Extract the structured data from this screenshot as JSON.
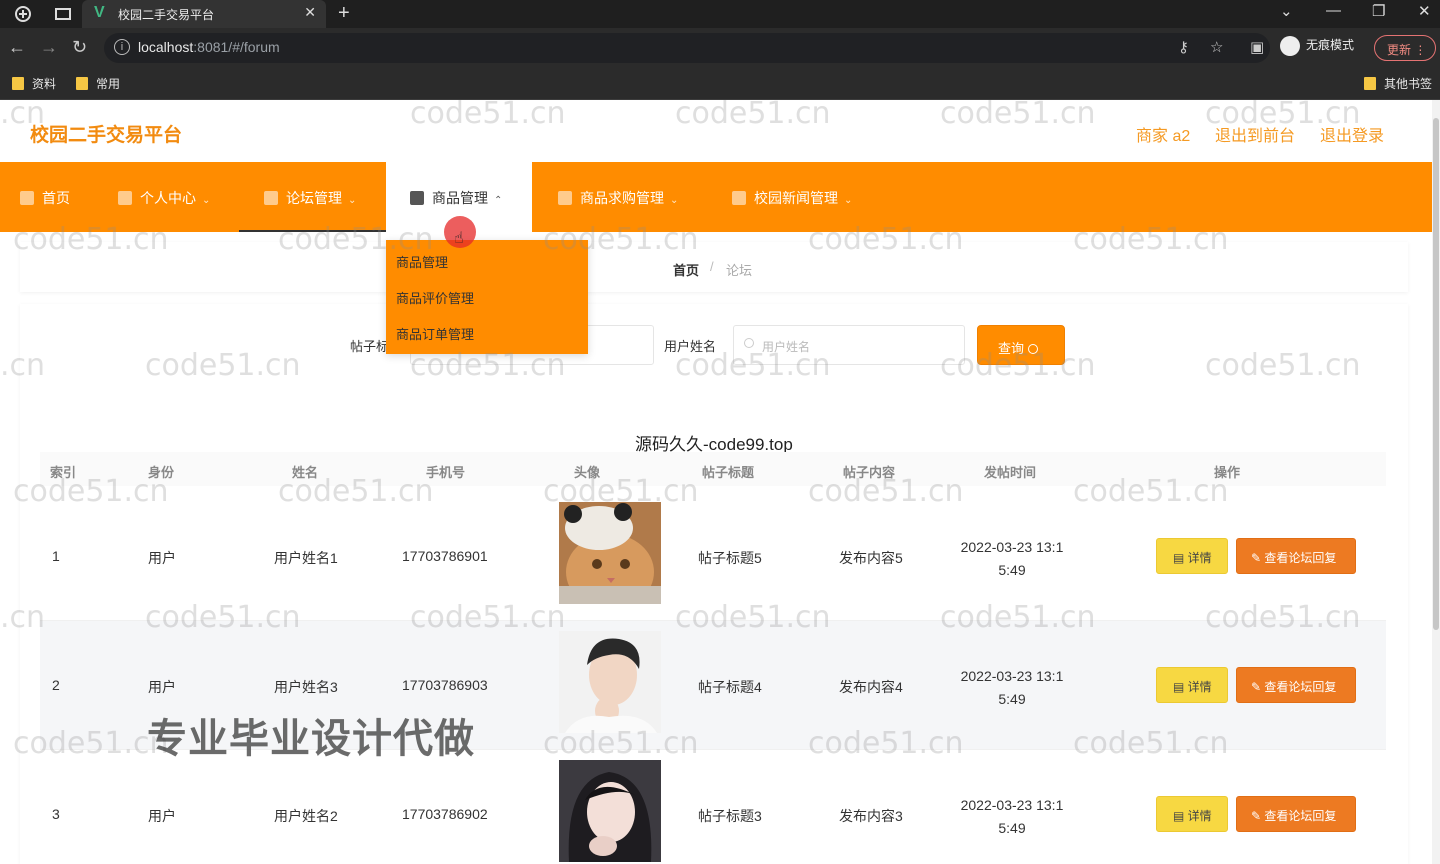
{
  "browser": {
    "tab_title": "校园二手交易平台",
    "url_host": "localhost",
    "url_rest": ":8081/#/forum",
    "incognito_label": "无痕模式",
    "update_label": "更新",
    "bookmarks": [
      "资料",
      "常用"
    ],
    "other_bookmarks": "其他书签"
  },
  "header": {
    "brand": "校园二手交易平台",
    "user": "商家 a2",
    "back_front": "退出到前台",
    "logout": "退出登录"
  },
  "menu": {
    "items": [
      "首页",
      "个人中心",
      "论坛管理",
      "商品管理",
      "商品求购管理",
      "校园新闻管理"
    ],
    "dropdown": [
      "商品管理",
      "商品评价管理",
      "商品订单管理"
    ]
  },
  "breadcrumb": {
    "home": "首页",
    "sep": "/",
    "current": "论坛"
  },
  "search": {
    "title_label": "帖子标题",
    "name_label": "用户姓名",
    "name_placeholder": "用户姓名",
    "query_label": "查询"
  },
  "table": {
    "caption": "源码久久-code99.top",
    "headers": [
      "索引",
      "身份",
      "姓名",
      "手机号",
      "头像",
      "帖子标题",
      "帖子内容",
      "发帖时间",
      "操作"
    ],
    "detail_label": "详情",
    "reply_label": "查看论坛回复",
    "rows": [
      {
        "index": "1",
        "role": "用户",
        "name": "用户姓名1",
        "phone": "17703786901",
        "title": "帖子标题5",
        "content": "发布内容5",
        "time1": "2022-03-23 13:1",
        "time2": "5:49"
      },
      {
        "index": "2",
        "role": "用户",
        "name": "用户姓名3",
        "phone": "17703786903",
        "title": "帖子标题4",
        "content": "发布内容4",
        "time1": "2022-03-23 13:1",
        "time2": "5:49"
      },
      {
        "index": "3",
        "role": "用户",
        "name": "用户姓名2",
        "phone": "17703786902",
        "title": "帖子标题3",
        "content": "发布内容3",
        "time1": "2022-03-23 13:1",
        "time2": "5:49"
      }
    ]
  },
  "overlay": {
    "watermark": "code51.cn",
    "watermark_left": ".cn",
    "promo": "专业毕业设计代做"
  }
}
